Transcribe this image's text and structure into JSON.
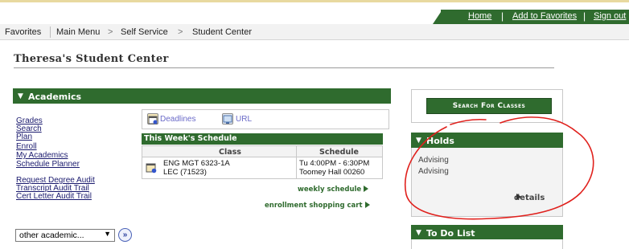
{
  "header": {
    "links": [
      "Home",
      "Add to Favorites",
      "Sign out"
    ]
  },
  "breadcrumb": {
    "items": [
      "Favorites",
      "Main Menu",
      "Self Service",
      "Student Center"
    ],
    "separator": ">"
  },
  "page": {
    "title": "Theresa's Student Center"
  },
  "academics": {
    "header": "Academics",
    "links": [
      "Grades",
      "Search",
      "Plan",
      "Enroll",
      "My Academics",
      "Schedule Planner"
    ],
    "audit_links": [
      "Request Degree Audit",
      "Transcript Audit Trail",
      "Cert Letter Audit Trail"
    ],
    "tools": {
      "deadlines": "Deadlines",
      "url": "URL"
    },
    "schedule": {
      "caption": "This Week's Schedule",
      "columns": [
        "Class",
        "Schedule"
      ],
      "rows": [
        {
          "class_line1": "ENG MGT 6323-1A",
          "class_line2": "LEC (71523)",
          "schedule_line1": "Tu 4:00PM - 6:30PM",
          "schedule_line2": "Toomey Hall 00260"
        }
      ]
    },
    "weekly_schedule_link": "weekly schedule",
    "shopping_cart_link": "enrollment shopping cart",
    "other_select": {
      "value": "other academic...",
      "caret": "▼"
    },
    "go_button": "»"
  },
  "search_button": "Search For Classes",
  "holds": {
    "header": "Holds",
    "items": [
      "Advising",
      "Advising"
    ],
    "details_link": "details"
  },
  "todo": {
    "header": "To Do List"
  },
  "colors": {
    "green": "#2f6b2e",
    "link_blue": "#1a1a6e",
    "annotation_red": "#e0201c"
  },
  "icons": {
    "pane_toggle": "triangle-down-icon",
    "deadlines": "calendar-icon",
    "url": "link-icon",
    "class_row": "calendar-icon",
    "go": "double-chevron-right-icon",
    "link_arrow": "triangle-right-icon"
  }
}
